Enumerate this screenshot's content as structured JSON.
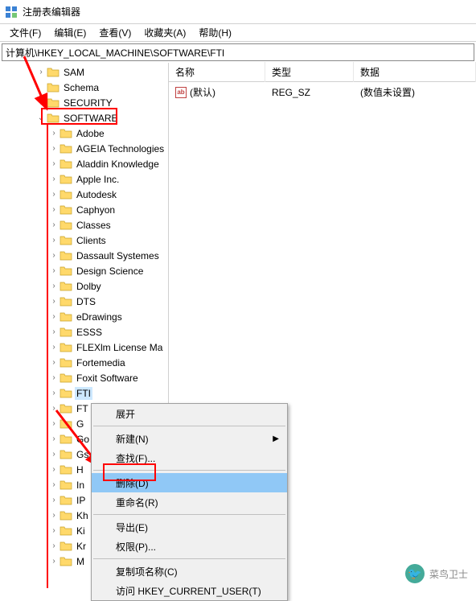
{
  "app": {
    "title": "注册表编辑器"
  },
  "menu": {
    "file": "文件(F)",
    "edit": "编辑(E)",
    "view": "查看(V)",
    "favorites": "收藏夹(A)",
    "help": "帮助(H)"
  },
  "address": "计算机\\HKEY_LOCAL_MACHINE\\SOFTWARE\\FTI",
  "columns": {
    "name": "名称",
    "type": "类型",
    "data": "数据"
  },
  "values": [
    {
      "name": "(默认)",
      "type": "REG_SZ",
      "data": "(数值未设置)"
    }
  ],
  "tree": {
    "items": [
      {
        "label": "SAM",
        "indent": 2,
        "chev": ">"
      },
      {
        "label": "Schema",
        "indent": 2,
        "chev": ""
      },
      {
        "label": "SECURITY",
        "indent": 2,
        "chev": ">"
      },
      {
        "label": "SOFTWARE",
        "indent": 2,
        "chev": "v"
      },
      {
        "label": "Adobe",
        "indent": 3,
        "chev": ">"
      },
      {
        "label": "AGEIA Technologies",
        "indent": 3,
        "chev": ">"
      },
      {
        "label": "Aladdin Knowledge",
        "indent": 3,
        "chev": ">"
      },
      {
        "label": "Apple Inc.",
        "indent": 3,
        "chev": ">"
      },
      {
        "label": "Autodesk",
        "indent": 3,
        "chev": ">"
      },
      {
        "label": "Caphyon",
        "indent": 3,
        "chev": ">"
      },
      {
        "label": "Classes",
        "indent": 3,
        "chev": ">"
      },
      {
        "label": "Clients",
        "indent": 3,
        "chev": ">"
      },
      {
        "label": "Dassault Systemes",
        "indent": 3,
        "chev": ">"
      },
      {
        "label": "Design Science",
        "indent": 3,
        "chev": ">"
      },
      {
        "label": "Dolby",
        "indent": 3,
        "chev": ">"
      },
      {
        "label": "DTS",
        "indent": 3,
        "chev": ">"
      },
      {
        "label": "eDrawings",
        "indent": 3,
        "chev": ">"
      },
      {
        "label": "ESSS",
        "indent": 3,
        "chev": ">"
      },
      {
        "label": "FLEXlm License Ma",
        "indent": 3,
        "chev": ">"
      },
      {
        "label": "Fortemedia",
        "indent": 3,
        "chev": ">"
      },
      {
        "label": "Foxit Software",
        "indent": 3,
        "chev": ">"
      },
      {
        "label": "FTI",
        "indent": 3,
        "chev": ">",
        "selected": true
      },
      {
        "label": "FT",
        "indent": 3,
        "chev": ">"
      },
      {
        "label": "G",
        "indent": 3,
        "chev": ">"
      },
      {
        "label": "Go",
        "indent": 3,
        "chev": ">"
      },
      {
        "label": "Gs",
        "indent": 3,
        "chev": ">"
      },
      {
        "label": "H",
        "indent": 3,
        "chev": ">"
      },
      {
        "label": "In",
        "indent": 3,
        "chev": ">"
      },
      {
        "label": "IP",
        "indent": 3,
        "chev": ">"
      },
      {
        "label": "Kh",
        "indent": 3,
        "chev": ">"
      },
      {
        "label": "Ki",
        "indent": 3,
        "chev": ">"
      },
      {
        "label": "Kr",
        "indent": 3,
        "chev": ">"
      },
      {
        "label": "M",
        "indent": 3,
        "chev": ">"
      }
    ]
  },
  "context_menu": {
    "expand": "展开",
    "new": "新建(N)",
    "find": "查找(F)...",
    "delete": "删除(D)",
    "rename": "重命名(R)",
    "export": "导出(E)",
    "permissions": "权限(P)...",
    "copy_key_name": "复制项名称(C)",
    "goto_hkcu": "访问 HKEY_CURRENT_USER(T)"
  },
  "watermark": {
    "text": "菜鸟卫士"
  }
}
